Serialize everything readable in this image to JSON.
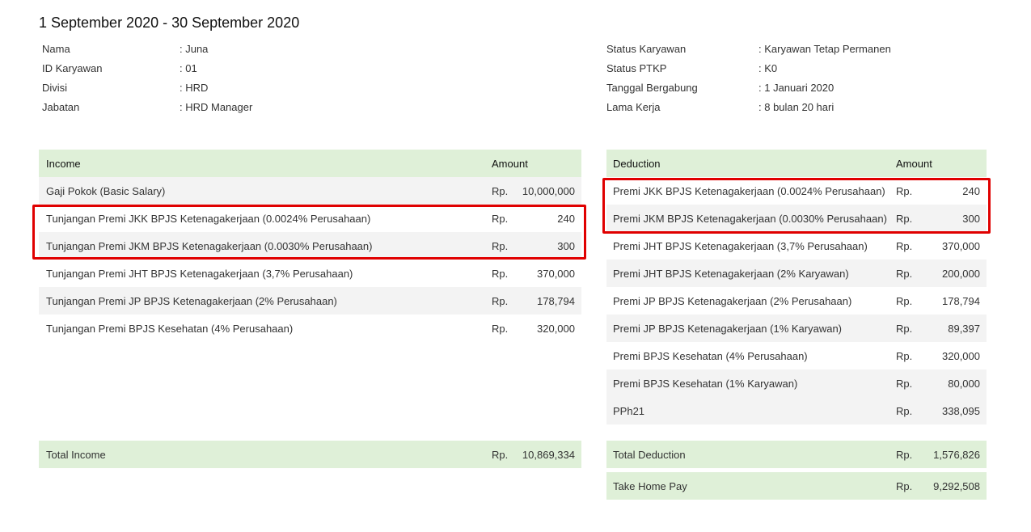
{
  "period": "1 September 2020 - 30 September 2020",
  "employee_left": [
    {
      "label": "Nama",
      "value": ": Juna"
    },
    {
      "label": "ID Karyawan",
      "value": ": 01"
    },
    {
      "label": "Divisi",
      "value": ": HRD"
    },
    {
      "label": "Jabatan",
      "value": ": HRD Manager"
    }
  ],
  "employee_right": [
    {
      "label": "Status Karyawan",
      "value": ": Karyawan Tetap Permanen"
    },
    {
      "label": "Status PTKP",
      "value": ": K0"
    },
    {
      "label": "Tanggal Bergabung",
      "value": ": 1 Januari 2020"
    },
    {
      "label": "Lama Kerja",
      "value": ": 8 bulan 20 hari"
    }
  ],
  "income": {
    "header_name": "Income",
    "header_amount": "Amount",
    "rows": [
      {
        "name": "Gaji Pokok (Basic Salary)",
        "currency": "Rp.",
        "amount": "10,000,000"
      },
      {
        "name": "Tunjangan Premi JKK BPJS Ketenagakerjaan (0.0024% Perusahaan)",
        "currency": "Rp.",
        "amount": "240"
      },
      {
        "name": "Tunjangan Premi JKM BPJS Ketenagakerjaan (0.0030% Perusahaan)",
        "currency": "Rp.",
        "amount": "300"
      },
      {
        "name": "Tunjangan Premi JHT BPJS Ketenagakerjaan (3,7% Perusahaan)",
        "currency": "Rp.",
        "amount": "370,000"
      },
      {
        "name": "Tunjangan Premi JP BPJS Ketenagakerjaan (2% Perusahaan)",
        "currency": "Rp.",
        "amount": "178,794"
      },
      {
        "name": "Tunjangan Premi BPJS Kesehatan (4% Perusahaan)",
        "currency": "Rp.",
        "amount": "320,000"
      }
    ],
    "total": {
      "name": "Total Income",
      "currency": "Rp.",
      "amount": "10,869,334"
    }
  },
  "deduction": {
    "header_name": "Deduction",
    "header_amount": "Amount",
    "rows": [
      {
        "name": "Premi JKK BPJS Ketenagakerjaan (0.0024% Perusahaan)",
        "currency": "Rp.",
        "amount": "240"
      },
      {
        "name": "Premi JKM BPJS Ketenagakerjaan (0.0030% Perusahaan)",
        "currency": "Rp.",
        "amount": "300"
      },
      {
        "name": "Premi JHT BPJS Ketenagakerjaan (3,7% Perusahaan)",
        "currency": "Rp.",
        "amount": "370,000"
      },
      {
        "name": "Premi JHT BPJS Ketenagakerjaan (2% Karyawan)",
        "currency": "Rp.",
        "amount": "200,000"
      },
      {
        "name": "Premi JP BPJS Ketenagakerjaan (2% Perusahaan)",
        "currency": "Rp.",
        "amount": "178,794"
      },
      {
        "name": "Premi JP BPJS Ketenagakerjaan (1% Karyawan)",
        "currency": "Rp.",
        "amount": "89,397"
      },
      {
        "name": "Premi BPJS Kesehatan (4% Perusahaan)",
        "currency": "Rp.",
        "amount": "320,000"
      },
      {
        "name": "Premi BPJS Kesehatan (1% Karyawan)",
        "currency": "Rp.",
        "amount": "80,000"
      },
      {
        "name": "PPh21",
        "currency": "Rp.",
        "amount": "338,095"
      }
    ],
    "total": {
      "name": "Total Deduction",
      "currency": "Rp.",
      "amount": "1,576,826"
    },
    "take_home": {
      "name": "Take Home Pay",
      "currency": "Rp.",
      "amount": "9,292,508"
    }
  },
  "colors": {
    "header_green": "#dff0d8",
    "row_gray": "#f3f3f3",
    "highlight_red": "#e00000"
  }
}
